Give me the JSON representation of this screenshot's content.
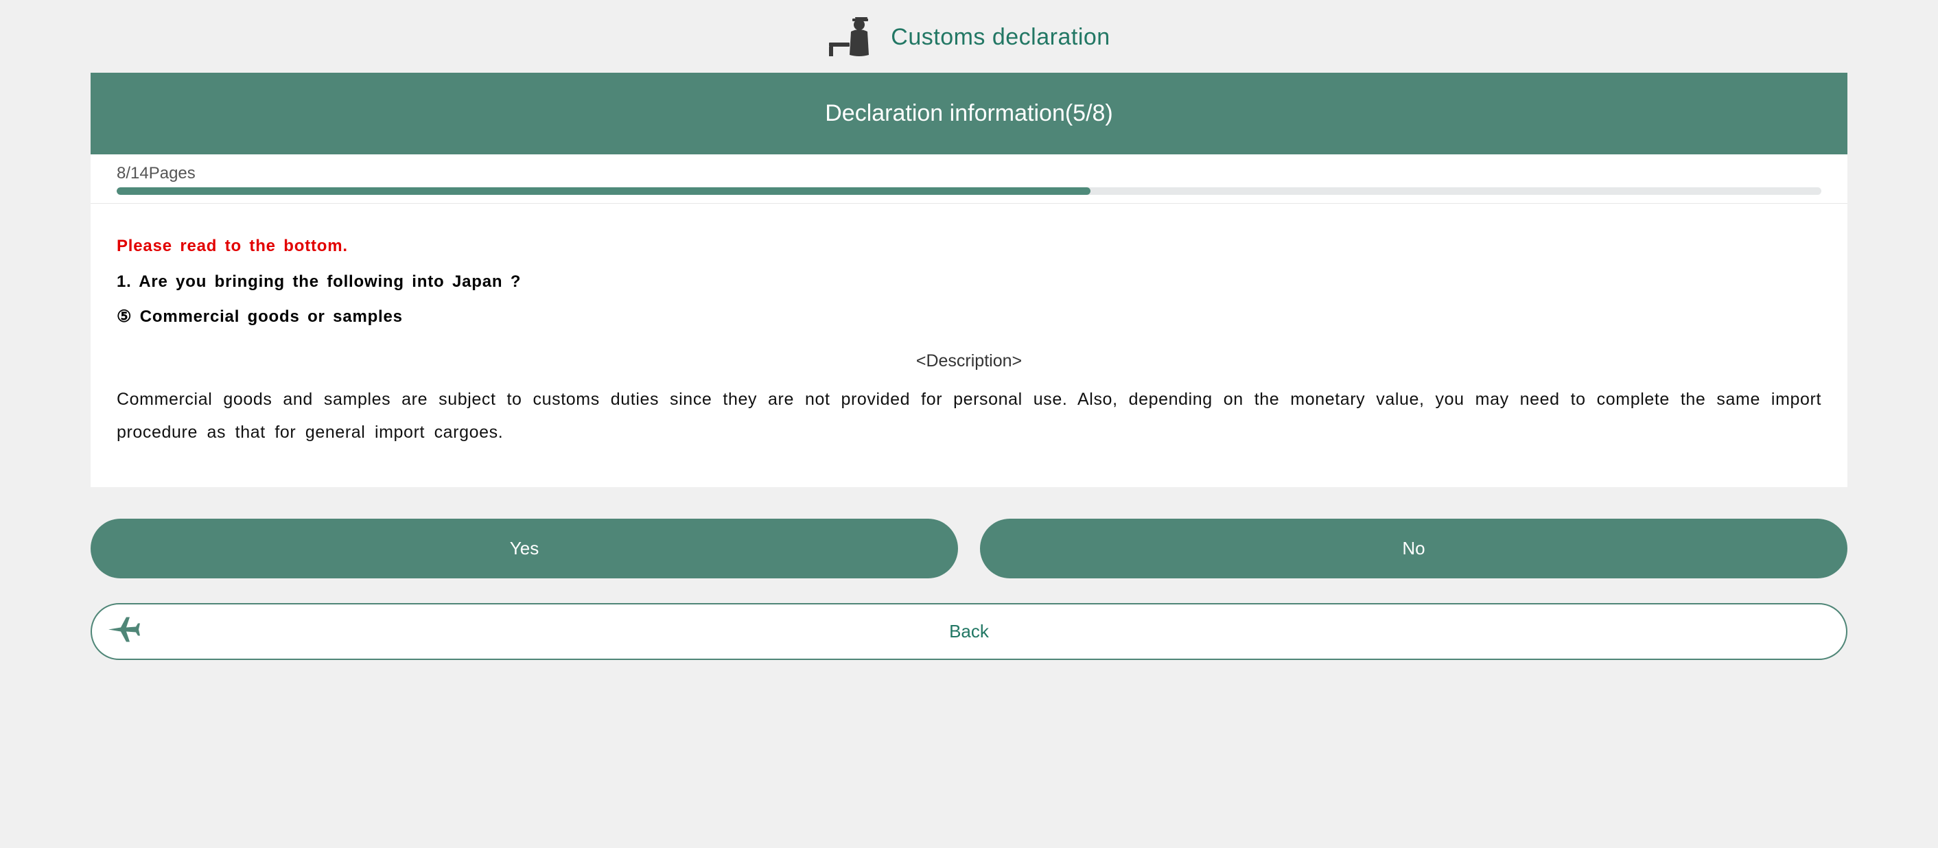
{
  "header": {
    "title": "Customs declaration"
  },
  "section": {
    "title": "Declaration information(5/8)"
  },
  "progress": {
    "label": "8/14Pages",
    "current": 8,
    "total": 14
  },
  "content": {
    "alert": "Please read to the bottom.",
    "question": "1. Are you bringing the following into Japan ?",
    "item": "⑤ Commercial goods or samples",
    "desc_heading": "<Description>",
    "description": "Commercial goods and samples are subject to customs duties since they are not provided for personal use. Also, depending on the monetary value, you may need to complete the same import procedure as that for general import cargoes."
  },
  "buttons": {
    "yes": "Yes",
    "no": "No",
    "back": "Back"
  },
  "colors": {
    "accent": "#4f8677",
    "accent_text": "#227764",
    "alert": "#e20000"
  }
}
